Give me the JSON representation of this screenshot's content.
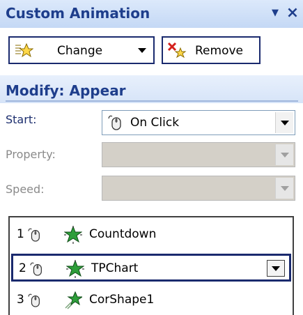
{
  "panel": {
    "title": "Custom Animation",
    "close_label": "×"
  },
  "toolbar": {
    "change_label": "Change",
    "remove_label": "Remove"
  },
  "modify": {
    "heading": "Modify: Appear",
    "start_label": "Start:",
    "start_value": "On Click",
    "property_label": "Property:",
    "property_value": "",
    "speed_label": "Speed:",
    "speed_value": ""
  },
  "animation_list": [
    {
      "order": "1",
      "name": "Countdown",
      "effect_icon": "entrance-star-icon",
      "selected": false
    },
    {
      "order": "2",
      "name": "TPChart",
      "effect_icon": "entrance-star-icon",
      "selected": true
    },
    {
      "order": "3",
      "name": "CorShape1",
      "effect_icon": "motion-star-icon",
      "selected": false
    }
  ],
  "colors": {
    "title_text": "#1e3e8c",
    "selection_border": "#1a2a6e",
    "star_green": "#2e9e3a"
  }
}
